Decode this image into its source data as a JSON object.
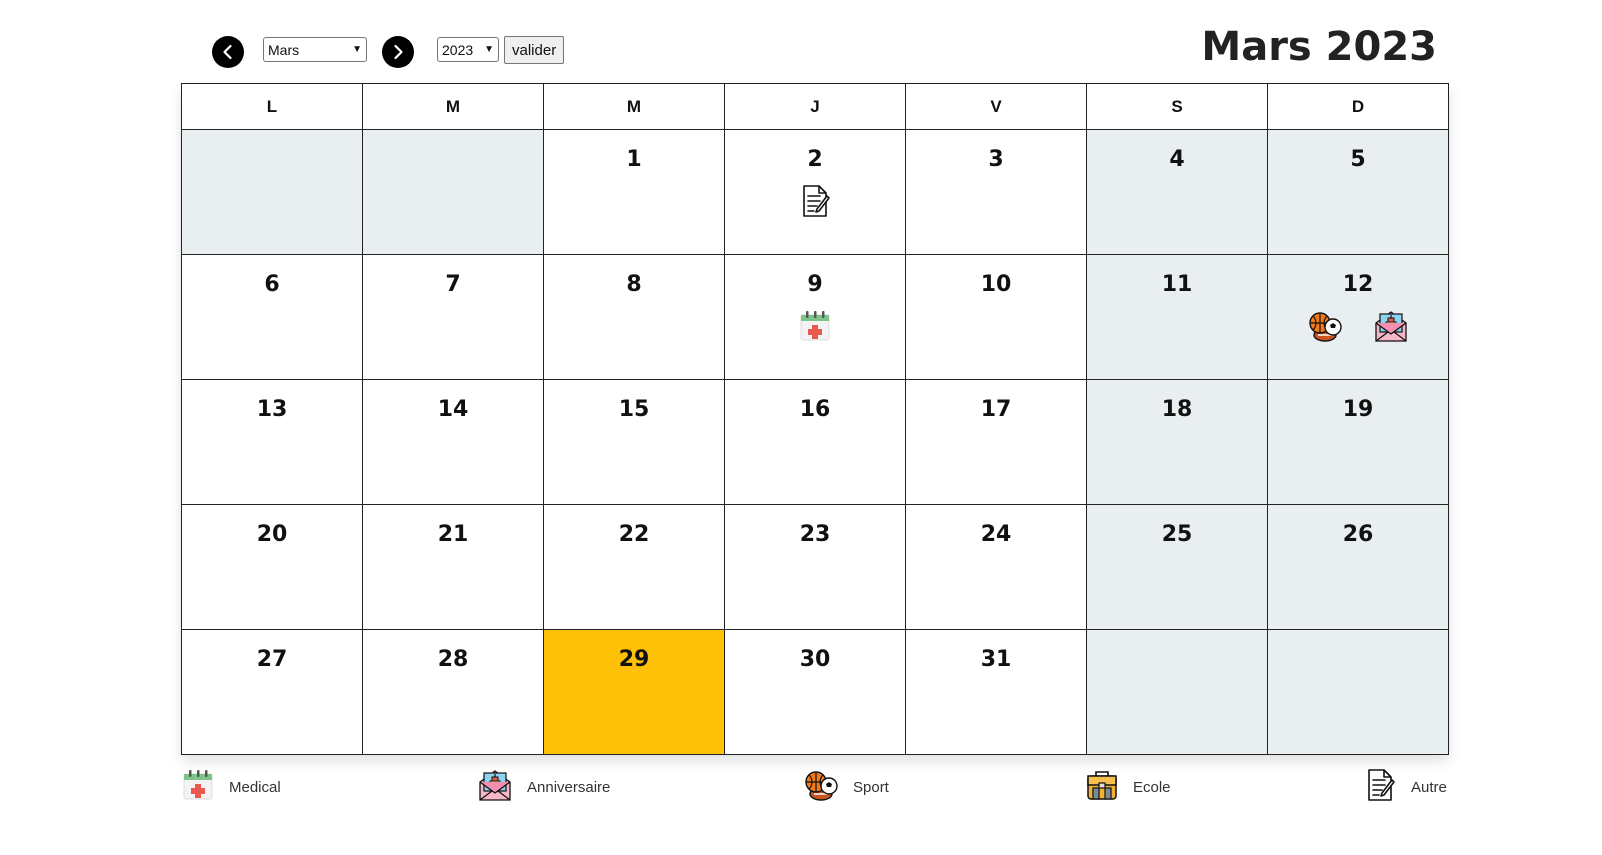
{
  "header": {
    "title": "Mars 2023",
    "month_select": "Mars",
    "year_select": "2023",
    "validate_label": "valider",
    "prev_icon": "chevron-left-icon",
    "next_icon": "chevron-right-icon"
  },
  "weekdays": [
    "L",
    "M",
    "M",
    "J",
    "V",
    "S",
    "D"
  ],
  "weeks": [
    [
      null,
      null,
      {
        "d": "1"
      },
      {
        "d": "2",
        "events": [
          "autre"
        ]
      },
      {
        "d": "3"
      },
      {
        "d": "4"
      },
      {
        "d": "5"
      }
    ],
    [
      {
        "d": "6"
      },
      {
        "d": "7"
      },
      {
        "d": "8"
      },
      {
        "d": "9",
        "events": [
          "medical"
        ]
      },
      {
        "d": "10"
      },
      {
        "d": "11"
      },
      {
        "d": "12",
        "events": [
          "sport",
          "anniversaire"
        ]
      }
    ],
    [
      {
        "d": "13"
      },
      {
        "d": "14"
      },
      {
        "d": "15"
      },
      {
        "d": "16"
      },
      {
        "d": "17"
      },
      {
        "d": "18"
      },
      {
        "d": "19"
      }
    ],
    [
      {
        "d": "20"
      },
      {
        "d": "21"
      },
      {
        "d": "22"
      },
      {
        "d": "23"
      },
      {
        "d": "24"
      },
      {
        "d": "25"
      },
      {
        "d": "26"
      }
    ],
    [
      {
        "d": "27"
      },
      {
        "d": "28"
      },
      {
        "d": "29",
        "today": true
      },
      {
        "d": "30"
      },
      {
        "d": "31"
      },
      null,
      null
    ]
  ],
  "colors": {
    "today": "#ffc107",
    "weekend": "#e9eef0",
    "nav_button": "#000000"
  },
  "legend": [
    {
      "key": "medical",
      "label": "Medical",
      "icon": "medical-calendar-icon"
    },
    {
      "key": "anniversaire",
      "label": "Anniversaire",
      "icon": "birthday-envelope-icon"
    },
    {
      "key": "sport",
      "label": "Sport",
      "icon": "sport-balls-icon"
    },
    {
      "key": "ecole",
      "label": "Ecole",
      "icon": "school-bag-icon"
    },
    {
      "key": "autre",
      "label": "Autre",
      "icon": "document-pen-icon"
    }
  ]
}
